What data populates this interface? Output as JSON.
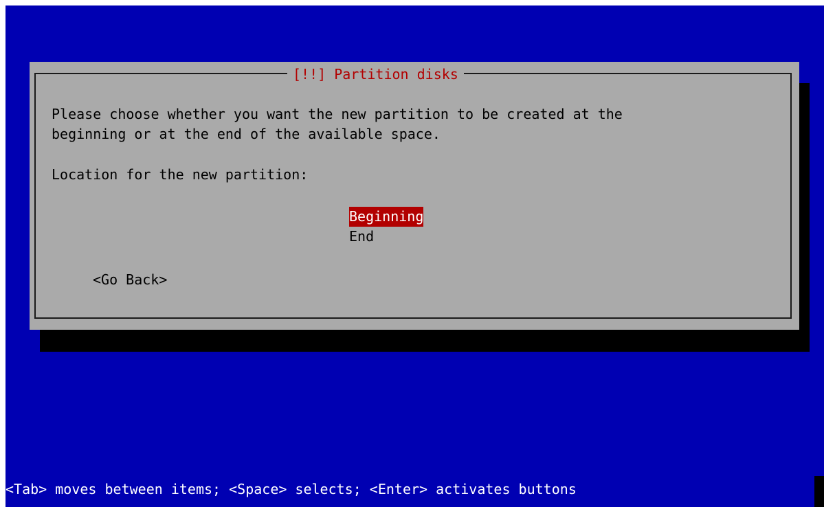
{
  "dialog": {
    "title": "[!!] Partition disks",
    "description_line1": "Please choose whether you want the new partition to be created at the",
    "description_line2": "beginning or at the end of the available space.",
    "prompt": "Location for the new partition:",
    "options": [
      {
        "label": "Beginning",
        "selected": true
      },
      {
        "label": "End",
        "selected": false
      }
    ],
    "go_back_label": "<Go Back>"
  },
  "footer": {
    "help_text": "<Tab> moves between items; <Space> selects; <Enter> activates buttons"
  },
  "colors": {
    "background": "#0000b2",
    "dialog": "#aaaaaa",
    "accent": "#b20000",
    "shadow": "#000000"
  }
}
